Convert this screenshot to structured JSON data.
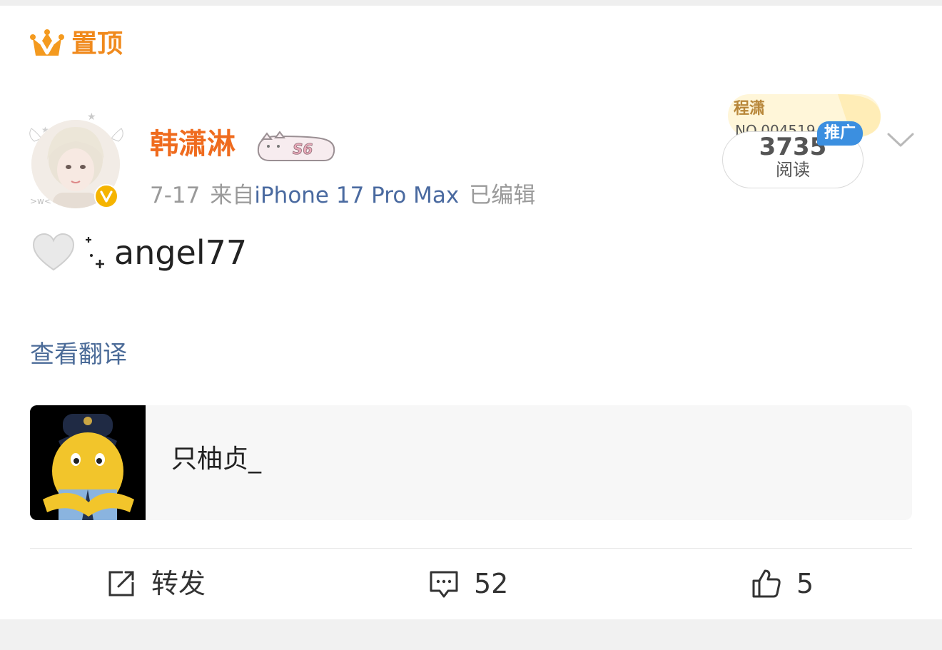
{
  "post": {
    "pinned_label": "置顶",
    "author": {
      "name": "韩潇淋",
      "level_badge": "S6",
      "verified": true
    },
    "meta": {
      "date": "7-17",
      "source_prefix": "来自",
      "device": "iPhone 17 Pro Max",
      "edited": "已编辑"
    },
    "promotion": {
      "badge_name": "程潇",
      "badge_no": "NO.004519",
      "tag": "推广",
      "reads_count": "3735",
      "reads_label": "阅读"
    },
    "content": {
      "emoji": "🤍",
      "text": "angel77"
    },
    "translate_label": "查看翻译",
    "quoted_user": {
      "name": "只柚贞_"
    },
    "actions": {
      "repost_label": "转发",
      "comments_count": "52",
      "likes_count": "5"
    }
  },
  "colors": {
    "accent_orange": "#ef6b1e",
    "link_blue": "#4b6b98",
    "promo_blue": "#3b8fe0",
    "meta_gray": "#9a9a9a"
  },
  "icons": [
    "crown-icon",
    "verified-icon",
    "more-chevron-icon",
    "heart-icon",
    "sparkle-icon",
    "repost-icon",
    "comment-icon",
    "like-icon"
  ]
}
